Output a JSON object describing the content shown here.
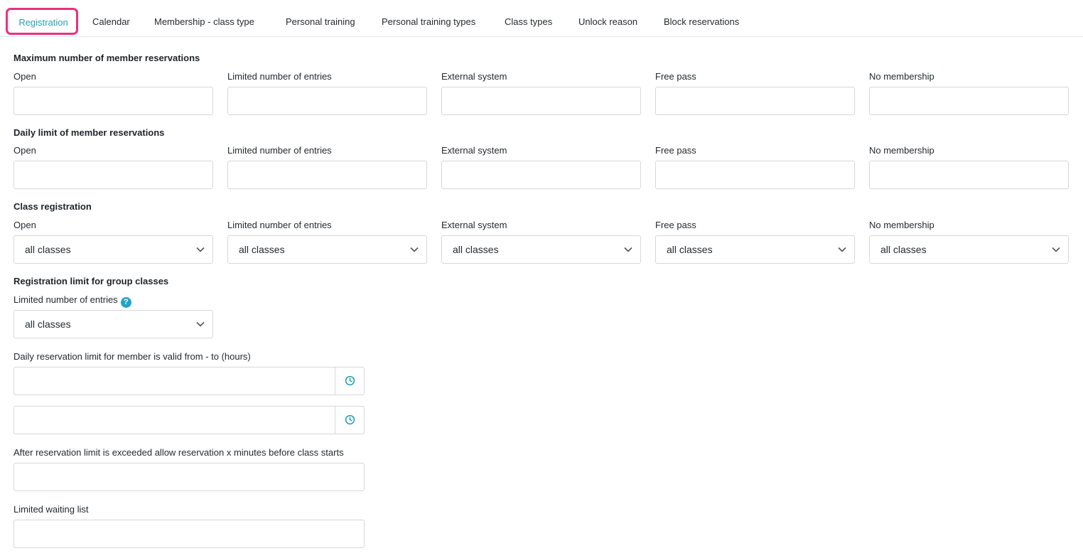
{
  "tabs": [
    {
      "label": "Registration"
    },
    {
      "label": "Calendar"
    },
    {
      "label": "Membership - class type"
    },
    {
      "label": "Personal training"
    },
    {
      "label": "Personal training types"
    },
    {
      "label": "Class types"
    },
    {
      "label": "Unlock reason"
    },
    {
      "label": "Block reservations"
    }
  ],
  "max_reservations": {
    "title": "Maximum number of member reservations",
    "fields": [
      "Open",
      "Limited number of entries",
      "External system",
      "Free pass",
      "No membership"
    ]
  },
  "daily_limit": {
    "title": "Daily limit of member reservations",
    "fields": [
      "Open",
      "Limited number of entries",
      "External system",
      "Free pass",
      "No membership"
    ]
  },
  "class_registration": {
    "title": "Class registration",
    "fields": [
      "Open",
      "Limited number of entries",
      "External system",
      "Free pass",
      "No membership"
    ],
    "values": [
      "all classes",
      "all classes",
      "all classes",
      "all classes",
      "all classes"
    ]
  },
  "group_limit": {
    "title": "Registration limit for group classes",
    "label": "Limited number of entries",
    "help_glyph": "?",
    "value": "all classes"
  },
  "daily_valid": {
    "label": "Daily reservation limit for member is valid from - to (hours)"
  },
  "exceeded": {
    "label": "After reservation limit is exceeded allow reservation x minutes before class starts"
  },
  "waiting": {
    "label": "Limited waiting list"
  },
  "colors": {
    "accent": "#2a9db5",
    "highlight": "#e8327a"
  }
}
